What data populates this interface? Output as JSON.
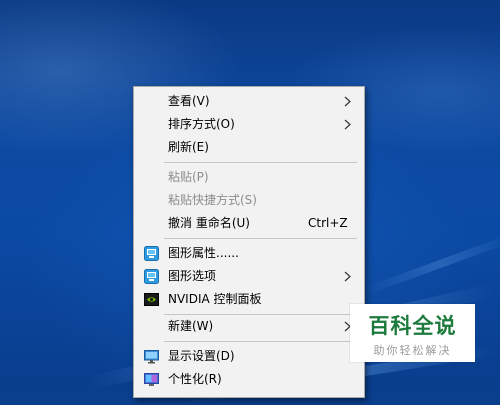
{
  "desktop": {
    "wallpaper": "windows-10-hero-blue"
  },
  "context_menu": {
    "items": [
      {
        "label": "查看(V)",
        "submenu": true
      },
      {
        "label": "排序方式(O)",
        "submenu": true
      },
      {
        "label": "刷新(E)"
      },
      {
        "label": "粘贴(P)",
        "disabled": true
      },
      {
        "label": "粘贴快捷方式(S)",
        "disabled": true
      },
      {
        "label": "撤消 重命名(U)",
        "shortcut": "Ctrl+Z"
      },
      {
        "label": "图形属性......",
        "icon": "intel-graphics-icon"
      },
      {
        "label": "图形选项",
        "icon": "intel-graphics-icon",
        "submenu": true
      },
      {
        "label": "NVIDIA 控制面板",
        "icon": "nvidia-icon"
      },
      {
        "label": "新建(W)",
        "submenu": true
      },
      {
        "label": "显示设置(D)",
        "icon": "display-icon"
      },
      {
        "label": "个性化(R)",
        "icon": "personalize-icon"
      }
    ]
  },
  "watermark": {
    "title": "百科全说",
    "subtitle": "助你轻松解决"
  },
  "colors": {
    "menu_bg": "#f2f2f2",
    "disabled_text": "#8d8d8d",
    "watermark_green": "#1c7a3c",
    "desktop_blue": "#0b4aa4"
  }
}
